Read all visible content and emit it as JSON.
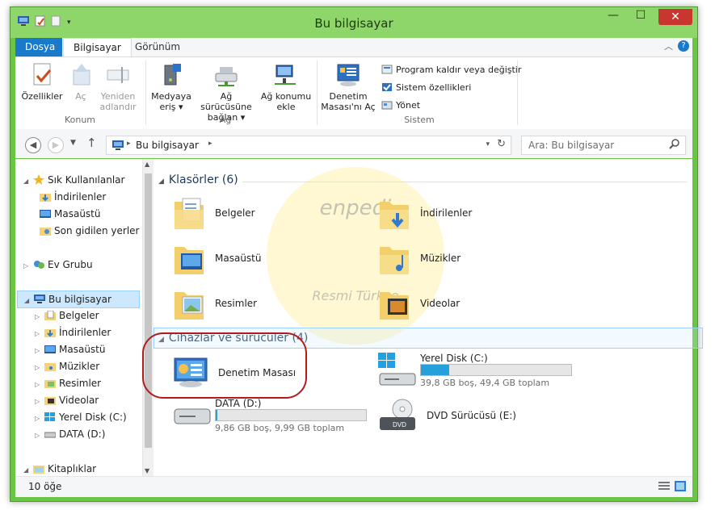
{
  "window": {
    "title": "Bu bilgisayar",
    "controls": {
      "minimize": "—",
      "maximize": "☐",
      "close": "✕"
    }
  },
  "ribbon_tabs": [
    {
      "label": "Dosya"
    },
    {
      "label": "Bilgisayar"
    },
    {
      "label": "Görünüm"
    }
  ],
  "ribbon": {
    "groups": [
      {
        "label": "Konum"
      },
      {
        "label": "Ağ"
      },
      {
        "label": "Sistem"
      }
    ],
    "buttons": {
      "ozellikler": "Özellikler",
      "ac": "Aç",
      "yeniden_line1": "Yeniden",
      "yeniden_line2": "adlandır",
      "medyaya_line1": "Medyaya",
      "medyaya_line2": "eriş",
      "ag_surucusu_line1": "Ağ sürücüsüne",
      "ag_surucusu_line2": "bağlan",
      "ag_konumu_line1": "Ağ konumu",
      "ag_konumu_line2": "ekle",
      "denetim_line1": "Denetim",
      "denetim_line2": "Masası'nı Aç",
      "program_kaldir": "Program kaldır veya değiştir",
      "sistem_ozellikleri": "Sistem özellikleri",
      "yonet": "Yönet"
    }
  },
  "address": {
    "path": "Bu bilgisayar",
    "search_placeholder": "Ara: Bu bilgisayar"
  },
  "nav": {
    "items": [
      {
        "label": "Sık Kullanılanlar"
      },
      {
        "label": "İndirilenler"
      },
      {
        "label": "Masaüstü"
      },
      {
        "label": "Son gidilen yerler"
      },
      {
        "label": "Ev Grubu"
      },
      {
        "label": "Bu bilgisayar"
      },
      {
        "label": "Belgeler"
      },
      {
        "label": "İndirilenler"
      },
      {
        "label": "Masaüstü"
      },
      {
        "label": "Müzikler"
      },
      {
        "label": "Resimler"
      },
      {
        "label": "Videolar"
      },
      {
        "label": "Yerel Disk (C:)"
      },
      {
        "label": "DATA (D:)"
      },
      {
        "label": "Kitaplıklar"
      }
    ]
  },
  "sections": {
    "folders_header": "Klasörler (6)",
    "devices_header": "Cihazlar ve sürücüler (4)"
  },
  "folders": [
    {
      "label": "Belgeler"
    },
    {
      "label": "İndirilenler"
    },
    {
      "label": "Masaüstü"
    },
    {
      "label": "Müzikler"
    },
    {
      "label": "Resimler"
    },
    {
      "label": "Videolar"
    }
  ],
  "devices": {
    "control_panel": "Denetim Masası",
    "c_drive": {
      "name": "Yerel Disk (C:)",
      "info": "39,8 GB boş, 49,4 GB toplam",
      "used_fraction": 0.19
    },
    "d_drive": {
      "name": "DATA (D:)",
      "info": "9,86 GB boş, 9,99 GB toplam",
      "used_fraction": 0.013
    },
    "dvd": {
      "name": "DVD Sürücüsü (E:)"
    }
  },
  "status": {
    "count": "10 öğe"
  },
  "watermark": {
    "brand": "enpedi",
    "sub": "Resmi Türkçe"
  },
  "colors": {
    "titlebar": "#8fd66a",
    "accent": "#1979ca",
    "drive_fill": "#26a0da",
    "annotation": "#b31b1b"
  }
}
